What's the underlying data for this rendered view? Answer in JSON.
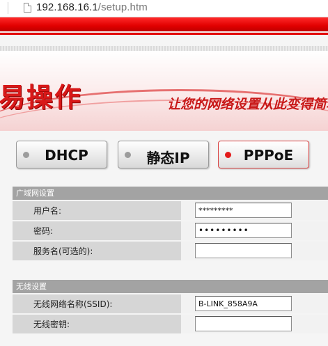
{
  "browser": {
    "url_host": "192.168.16.1",
    "url_path": "/setup.htm"
  },
  "banner": {
    "title": "易操作",
    "slogan": "让您的网络设置从此变得简单"
  },
  "modes": {
    "dhcp": "DHCP",
    "static": "静态IP",
    "pppoe": "PPPoE",
    "selected": "PPPoE"
  },
  "wan": {
    "header": "广域网设置",
    "username_label": "用户名:",
    "username_value": "*********",
    "password_label": "密码:",
    "password_value": "123456789",
    "service_label": "服务名(可选的):",
    "service_value": ""
  },
  "wireless": {
    "header": "无线设置",
    "ssid_label": "无线网络名称(SSID):",
    "ssid_value": "B-LINK_858A9A",
    "key_label": "无线密钥:",
    "key_value": ""
  },
  "colors": {
    "brand_red": "#e10000",
    "active_dot": "#e31b1b",
    "inactive_dot": "#9c9c9c"
  }
}
